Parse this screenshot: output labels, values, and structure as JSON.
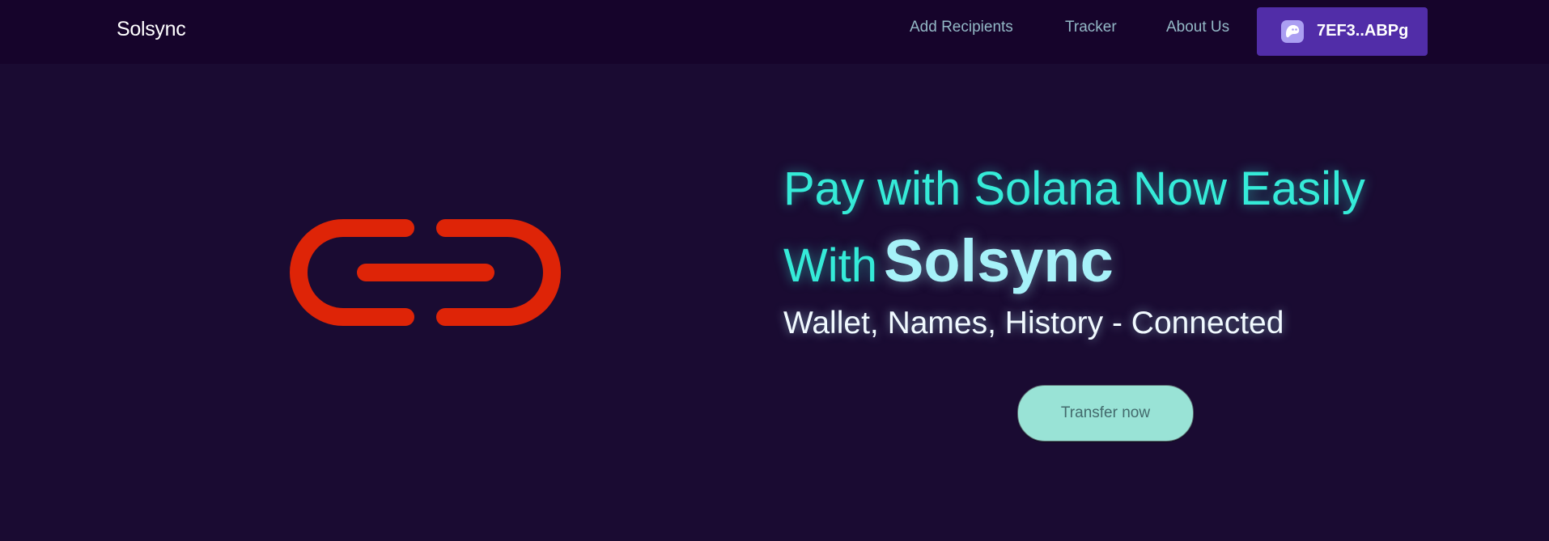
{
  "navbar": {
    "brand": "Solsync",
    "links": {
      "add_recipients": "Add Recipients",
      "tracker": "Tracker",
      "about_us": "About Us"
    },
    "wallet": {
      "label": "7EF3..ABPg",
      "icon": "phantom-ghost-icon"
    }
  },
  "hero": {
    "logo_icon": "chain-link-icon",
    "headline_line1": "Pay with Solana Now Easily",
    "headline_with": "With",
    "headline_brand": "Solsync",
    "subline": "Wallet, Names, History - Connected",
    "cta_label": "Transfer now"
  },
  "colors": {
    "background": "#1a0b32",
    "navbar": "#16042b",
    "accent_teal": "#35ebd8",
    "wallet_button": "#512da8",
    "logo_red": "#de2407",
    "cta": "#99e3d6"
  }
}
